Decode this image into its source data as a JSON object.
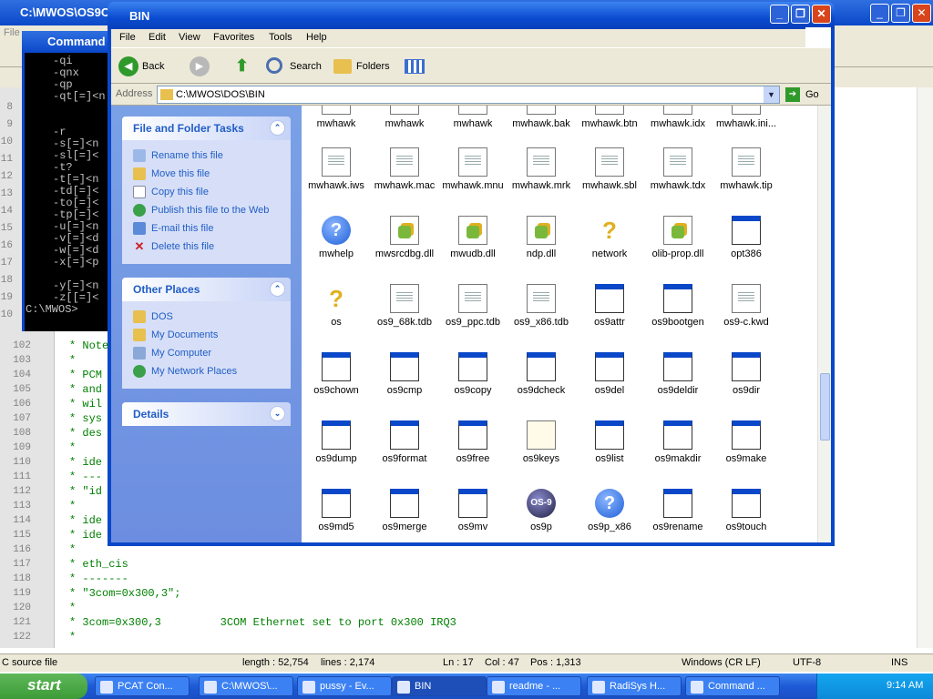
{
  "editor": {
    "title": "C:\\MWOS\\OS9C",
    "menu_first": "File",
    "lines": [
      {
        "n": "102",
        "t": "* Note"
      },
      {
        "n": "103",
        "t": "*"
      },
      {
        "n": "104",
        "t": "* PCM"
      },
      {
        "n": "105",
        "t": "* and"
      },
      {
        "n": "106",
        "t": "* wil"
      },
      {
        "n": "107",
        "t": "* sys"
      },
      {
        "n": "108",
        "t": "* des"
      },
      {
        "n": "109",
        "t": "*"
      },
      {
        "n": "110",
        "t": "* ide"
      },
      {
        "n": "111",
        "t": "* ---"
      },
      {
        "n": "112",
        "t": "* \"id"
      },
      {
        "n": "113",
        "t": "*"
      },
      {
        "n": "114",
        "t": "* ide"
      },
      {
        "n": "115",
        "t": "* ide"
      },
      {
        "n": "116",
        "t": "*"
      },
      {
        "n": "117",
        "t": "* eth_cis"
      },
      {
        "n": "118",
        "t": "* -------"
      },
      {
        "n": "119",
        "t": "* \"3com=0x300,3\";"
      },
      {
        "n": "120",
        "t": "*"
      },
      {
        "n": "121",
        "t": "* 3com=0x300,3         3COM Ethernet set to port 0x300 IRQ3"
      },
      {
        "n": "122",
        "t": "*"
      }
    ],
    "gutter_top": [
      "8",
      "9",
      "10",
      "11",
      "12",
      "13",
      "14",
      "15",
      "16",
      "17",
      "18",
      "19",
      "10"
    ],
    "status": {
      "type": "C source file",
      "length": "length : 52,754",
      "lines": "lines : 2,174",
      "ln": "Ln : 17",
      "col": "Col : 47",
      "pos": "Pos : 1,313",
      "eol": "Windows (CR LF)",
      "enc": "UTF-8",
      "mode": "INS"
    }
  },
  "cmd": {
    "title": "Command",
    "lines": [
      "-qi",
      "-qnx",
      "-qp",
      "-qt[=]<n",
      "",
      "",
      "-r",
      "-s[=]<n",
      "-sl[=]<",
      "-t?",
      "-t[=]<n",
      "-td[=]<",
      "-to[=]<",
      "-tp[=]<",
      "-u[=]<n",
      "-v[=]<d",
      "-w[=]<d",
      "-x[=]<p",
      "",
      "-y[=]<n",
      "-z[[=]<",
      "C:\\MWOS>"
    ]
  },
  "explorer": {
    "title": "BIN",
    "menu": [
      "File",
      "Edit",
      "View",
      "Favorites",
      "Tools",
      "Help"
    ],
    "toolbar": {
      "back": "Back",
      "search": "Search",
      "folders": "Folders"
    },
    "address_label": "Address",
    "address": "C:\\MWOS\\DOS\\BIN",
    "go": "Go",
    "tasks": {
      "title": "File and Folder Tasks",
      "items": [
        "Rename this file",
        "Move this file",
        "Copy this file",
        "Publish this file to the Web",
        "E-mail this file",
        "Delete this file"
      ]
    },
    "places": {
      "title": "Other Places",
      "items": [
        "DOS",
        "My Documents",
        "My Computer",
        "My Network Places"
      ]
    },
    "details": {
      "title": "Details"
    },
    "files": [
      [
        {
          "n": "mwhawk",
          "i": "doc"
        },
        {
          "n": "mwhawk",
          "i": "doc"
        },
        {
          "n": "mwhawk",
          "i": "doc"
        },
        {
          "n": "mwhawk.bak",
          "i": "doc"
        },
        {
          "n": "mwhawk.btn",
          "i": "doc"
        },
        {
          "n": "mwhawk.idx",
          "i": "doc"
        },
        {
          "n": "mwhawk.ini...",
          "i": "doc"
        }
      ],
      [
        {
          "n": "mwhawk.iws",
          "i": "doc"
        },
        {
          "n": "mwhawk.mac",
          "i": "doc"
        },
        {
          "n": "mwhawk.mnu",
          "i": "doc"
        },
        {
          "n": "mwhawk.mrk",
          "i": "doc"
        },
        {
          "n": "mwhawk.sbl",
          "i": "doc"
        },
        {
          "n": "mwhawk.tdx",
          "i": "doc"
        },
        {
          "n": "mwhawk.tip",
          "i": "doc"
        }
      ],
      [
        {
          "n": "mwhelp",
          "i": "help"
        },
        {
          "n": "mwsrcdbg.dll",
          "i": "dll"
        },
        {
          "n": "mwudb.dll",
          "i": "dll"
        },
        {
          "n": "ndp.dll",
          "i": "dll"
        },
        {
          "n": "network",
          "i": "q"
        },
        {
          "n": "olib-prop.dll",
          "i": "dll"
        },
        {
          "n": "opt386",
          "i": "exe"
        }
      ],
      [
        {
          "n": "os",
          "i": "q"
        },
        {
          "n": "os9_68k.tdb",
          "i": "doc"
        },
        {
          "n": "os9_ppc.tdb",
          "i": "doc"
        },
        {
          "n": "os9_x86.tdb",
          "i": "doc"
        },
        {
          "n": "os9attr",
          "i": "exe"
        },
        {
          "n": "os9bootgen",
          "i": "exe"
        },
        {
          "n": "os9-c.kwd",
          "i": "doc"
        }
      ],
      [
        {
          "n": "os9chown",
          "i": "exe"
        },
        {
          "n": "os9cmp",
          "i": "exe"
        },
        {
          "n": "os9copy",
          "i": "exe"
        },
        {
          "n": "os9dcheck",
          "i": "exe"
        },
        {
          "n": "os9del",
          "i": "exe"
        },
        {
          "n": "os9deldir",
          "i": "exe"
        },
        {
          "n": "os9dir",
          "i": "exe"
        }
      ],
      [
        {
          "n": "os9dump",
          "i": "exe"
        },
        {
          "n": "os9format",
          "i": "exe"
        },
        {
          "n": "os9free",
          "i": "exe"
        },
        {
          "n": "os9keys",
          "i": "txt"
        },
        {
          "n": "os9list",
          "i": "exe"
        },
        {
          "n": "os9makdir",
          "i": "exe"
        },
        {
          "n": "os9make",
          "i": "exe"
        }
      ],
      [
        {
          "n": "os9md5",
          "i": "exe"
        },
        {
          "n": "os9merge",
          "i": "exe"
        },
        {
          "n": "os9mv",
          "i": "exe"
        },
        {
          "n": "os9p",
          "i": "os9"
        },
        {
          "n": "os9p_x86",
          "i": "help"
        },
        {
          "n": "os9rename",
          "i": "exe"
        },
        {
          "n": "os9touch",
          "i": "exe"
        }
      ]
    ]
  },
  "taskbar": {
    "start": "start",
    "items": [
      "PCAT Con...",
      "C:\\MWOS\\...",
      "pussy - Ev...",
      "BIN",
      "readme - ...",
      "RadiSys H...",
      "Command ..."
    ],
    "clock": "9:14 AM"
  }
}
